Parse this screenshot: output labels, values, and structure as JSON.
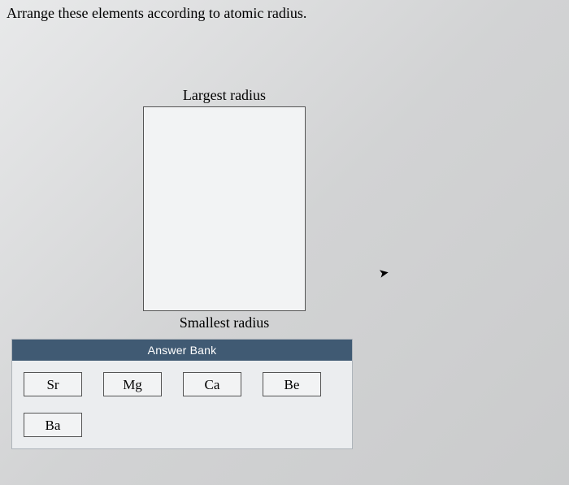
{
  "question": "Arrange these elements according to atomic radius.",
  "labels": {
    "top": "Largest radius",
    "bottom": "Smallest radius"
  },
  "answer_bank": {
    "header": "Answer Bank",
    "tiles": [
      "Sr",
      "Mg",
      "Ca",
      "Be",
      "Ba"
    ]
  }
}
